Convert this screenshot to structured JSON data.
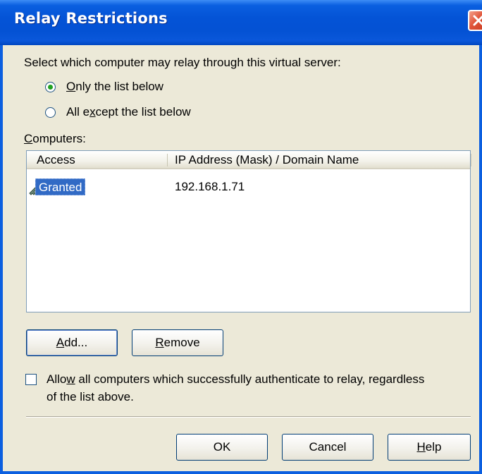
{
  "window": {
    "title": "Relay Restrictions",
    "close_icon": "close-icon"
  },
  "prompt": "Select which computer may relay through this virtual server:",
  "radio_options": [
    {
      "prefix": "",
      "mnemonic": "O",
      "rest": "nly the list below",
      "selected": true
    },
    {
      "prefix": "All e",
      "mnemonic": "x",
      "rest": "cept the list below",
      "selected": false
    }
  ],
  "computers_label": {
    "mnemonic": "C",
    "rest": "omputers:"
  },
  "list": {
    "columns": [
      "Access",
      "IP Address (Mask) / Domain Name"
    ],
    "rows": [
      {
        "access": "Granted",
        "address": "192.168.1.71",
        "icon": "key-icon",
        "selected": true
      }
    ]
  },
  "buttons": {
    "add": {
      "mnemonic": "A",
      "rest": "dd..."
    },
    "remove": {
      "mnemonic": "R",
      "rest": "emove"
    },
    "ok": "OK",
    "cancel": "Cancel",
    "help": {
      "mnemonic": "H",
      "rest": "elp"
    }
  },
  "allow_auth": {
    "checked": false,
    "line1_prefix": "Allo",
    "line1_mnemonic": "w",
    "line1_rest": " all computers which successfully authenticate to relay, regardless",
    "line2": "of the list above."
  },
  "colors": {
    "titlebar": "#0453D6",
    "selection": "#316AC5",
    "dialog_bg": "#ECE9D8"
  }
}
